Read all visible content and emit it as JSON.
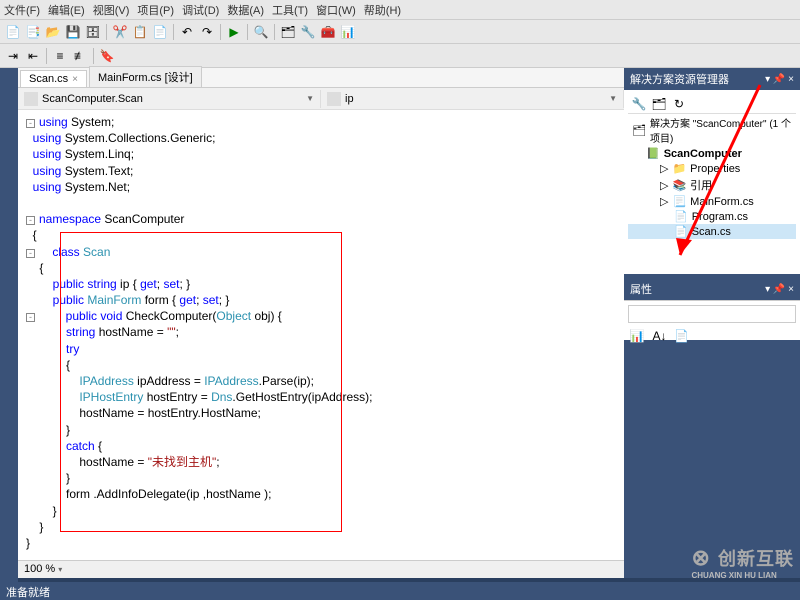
{
  "menu": {
    "file": "文件(F)",
    "edit": "编辑(E)",
    "view": "视图(V)",
    "project": "项目(P)",
    "debug": "调试(D)",
    "data": "数据(A)",
    "tools": "工具(T)",
    "window": "窗口(W)",
    "help": "帮助(H)"
  },
  "tabs": {
    "active": "Scan.cs",
    "second": "MainForm.cs [设计]"
  },
  "nav": {
    "left": "ScanComputer.Scan",
    "right": "ip"
  },
  "code": {
    "l1a": "using",
    "l1b": " System;",
    "l2a": "using",
    "l2b": " System.Collections.Generic;",
    "l3a": "using",
    "l3b": " System.Linq;",
    "l4a": "using",
    "l4b": " System.Text;",
    "l5a": "using",
    "l5b": " System.Net;",
    "l6a": "namespace",
    "l6b": " ScanComputer",
    "l7": "{",
    "l8a": "    class",
    "l8b": " Scan",
    "l9": "    {",
    "l10a": "        public",
    "l10b": " string",
    "l10c": " ip { ",
    "l10d": "get",
    "l10e": "; ",
    "l10f": "set",
    "l10g": "; }",
    "l11a": "        public",
    "l11b": " MainForm",
    "l11c": " form { ",
    "l11d": "get",
    "l11e": "; ",
    "l11f": "set",
    "l11g": "; }",
    "l12a": "        public",
    "l12b": " void",
    "l12c": " CheckComputer(",
    "l12d": "Object",
    "l12e": " obj) {",
    "l13a": "            string",
    "l13b": " hostName = ",
    "l13c": "\"\"",
    "l13d": ";",
    "l14": "            try",
    "l15": "            {",
    "l16a": "                IPAddress",
    "l16b": " ipAddress = ",
    "l16c": "IPAddress",
    "l16d": ".Parse(ip);",
    "l17a": "                IPHostEntry",
    "l17b": " hostEntry = ",
    "l17c": "Dns",
    "l17d": ".GetHostEntry(ipAddress);",
    "l18": "                hostName = hostEntry.HostName;",
    "l19": "            }",
    "l20a": "            catch",
    "l20b": " {",
    "l21a": "                hostName = ",
    "l21b": "\"未找到主机\"",
    "l21c": ";",
    "l22": "            }",
    "l23": "            form .AddInfoDelegate(ip ,hostName );",
    "l24": "        }",
    "l25": "    }",
    "l26": "}"
  },
  "zoom": "100 %",
  "solution": {
    "title": "解决方案资源管理器",
    "root": "解决方案 \"ScanComputer\" (1 个项目)",
    "project": "ScanComputer",
    "properties": "Properties",
    "references": "引用",
    "mainform": "MainForm.cs",
    "program": "Program.cs",
    "scan": "Scan.cs"
  },
  "props": {
    "title": "属性"
  },
  "status": "准备就绪",
  "watermark": "创新互联",
  "watermark_sub": "CHUANG XIN HU LIAN"
}
